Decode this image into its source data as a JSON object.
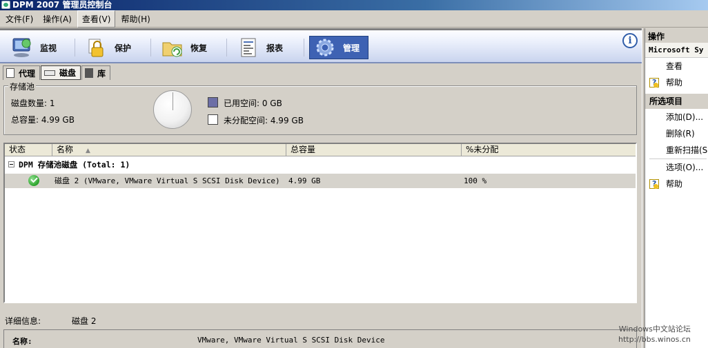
{
  "window": {
    "title": "DPM 2007 管理员控制台"
  },
  "menubar": {
    "items": [
      "文件(F)",
      "操作(A)",
      "查看(V)",
      "帮助(H)"
    ]
  },
  "nav": {
    "tabs": [
      {
        "label": "监视",
        "icon": "monitor-icon"
      },
      {
        "label": "保护",
        "icon": "protection-lock-icon"
      },
      {
        "label": "恢复",
        "icon": "recovery-folder-icon"
      },
      {
        "label": "报表",
        "icon": "report-icon"
      },
      {
        "label": "管理",
        "icon": "management-gear-icon"
      }
    ],
    "active": "管理"
  },
  "subtabs": {
    "items": [
      "代理",
      "磁盘",
      "库"
    ],
    "active": "磁盘"
  },
  "storage_pool": {
    "title": "存储池",
    "disk_count": "磁盘数量: 1",
    "total_capacity": "总容量: 4.99 GB",
    "used_space": "已用空间: 0 GB",
    "unallocated_space": "未分配空间: 4.99 GB",
    "colors": {
      "used": "#6d6fa6",
      "free": "#ffffff"
    }
  },
  "disk_list": {
    "columns": [
      "状态",
      "名称",
      "总容量",
      "%未分配"
    ],
    "group_label": "DPM 存储池磁盘 (Total: 1)",
    "rows": [
      {
        "status_icon": "ok-check-icon",
        "name": "磁盘 2 (VMware, VMware Virtual S SCSI Disk Device)",
        "capacity": "4.99 GB",
        "unallocated": "100 %"
      }
    ]
  },
  "details": {
    "label": "详细信息:",
    "value": "磁盘 2",
    "name_label": "名称:",
    "name_value": "VMware, VMware Virtual S SCSI Disk Device"
  },
  "actions_pane": {
    "header": "操作",
    "context": "Microsoft Sy",
    "top_items": [
      {
        "label": "查看",
        "icon": ""
      },
      {
        "label": "帮助",
        "icon": "help-icon"
      }
    ],
    "selected_group": "所选项目",
    "selected_items": [
      {
        "label": "添加(D)...",
        "icon": ""
      },
      {
        "label": "删除(R)",
        "icon": ""
      },
      {
        "label": "重新扫描(S",
        "icon": ""
      },
      {
        "label": "选项(O)...",
        "icon": ""
      },
      {
        "label": "帮助",
        "icon": "help-icon"
      }
    ]
  },
  "watermark": {
    "line1": "Windows中文站论坛",
    "line2": "http://bbs.winos.cn"
  }
}
